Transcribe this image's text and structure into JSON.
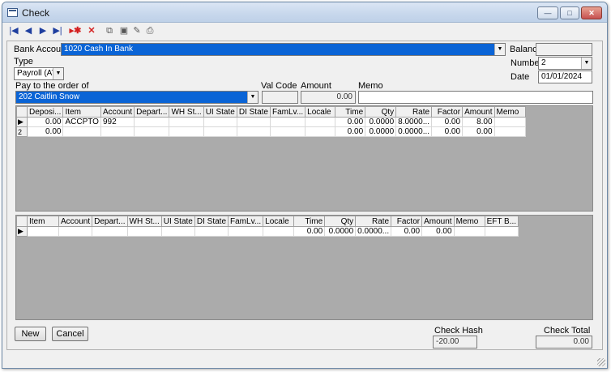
{
  "window": {
    "title": "Check",
    "controls": {
      "minimize": "—",
      "maximize": "□",
      "close": "✕"
    }
  },
  "toolbar": {
    "icons": [
      "first-record",
      "previous-record",
      "next-record",
      "last-record",
      "insert-record",
      "delete-record",
      "find",
      "save",
      "edit",
      "print"
    ]
  },
  "form": {
    "bank_account_label": "Bank Account",
    "bank_account_value": "1020     Cash In Bank",
    "balance_label": "Balance",
    "balance_value": "",
    "type_label": "Type",
    "type_value": "Payroll (ATF",
    "number_label": "Number",
    "number_value": "2",
    "date_label": "Date",
    "date_value": "01/01/2024",
    "pay_to_label": "Pay to the order of",
    "pay_to_value": "202 Caitlin Snow",
    "val_code_label": "Val Code",
    "val_code_value": "",
    "amount_label": "Amount",
    "amount_value": "0.00",
    "memo_label": "Memo",
    "memo_value": ""
  },
  "grid1": {
    "columns": [
      "Deposi...",
      "Item",
      "Account",
      "Depart...",
      "WH St...",
      "UI State",
      "DI State",
      "FamLv...",
      "Locale",
      "Time",
      "Qty",
      "Rate",
      "Factor",
      "Amount",
      "Memo"
    ],
    "rows": [
      {
        "indicator": "▶",
        "cells": [
          "0.00",
          "ACCPTO",
          "992",
          "",
          "",
          "",
          "",
          "",
          "",
          "0.00",
          "0.0000",
          "8.0000...",
          "0.00",
          "8.00",
          ""
        ]
      },
      {
        "indicator": "2",
        "cells": [
          "0.00",
          "",
          "",
          "",
          "",
          "",
          "",
          "",
          "",
          "0.00",
          "0.0000",
          "0.0000...",
          "0.00",
          "0.00",
          ""
        ]
      }
    ]
  },
  "grid2": {
    "columns": [
      "Item",
      "Account",
      "Depart...",
      "WH St...",
      "UI State",
      "DI State",
      "FamLv...",
      "Locale",
      "Time",
      "Qty",
      "Rate",
      "Factor",
      "Amount",
      "Memo",
      "EFT B..."
    ],
    "rows": [
      {
        "indicator": "▶",
        "cells": [
          "",
          "",
          "",
          "",
          "",
          "",
          "",
          "",
          "0.00",
          "0.0000",
          "0.0000...",
          "0.00",
          "0.00",
          "",
          ""
        ]
      }
    ]
  },
  "footer": {
    "new_label": "New",
    "cancel_label": "Cancel",
    "check_hash_label": "Check Hash",
    "check_hash_value": "-20.00",
    "check_total_label": "Check Total",
    "check_total_value": "0.00"
  },
  "colors": {
    "selection": "#0a64d6",
    "grid_background": "#ababab",
    "delete_red": "#d42020"
  }
}
